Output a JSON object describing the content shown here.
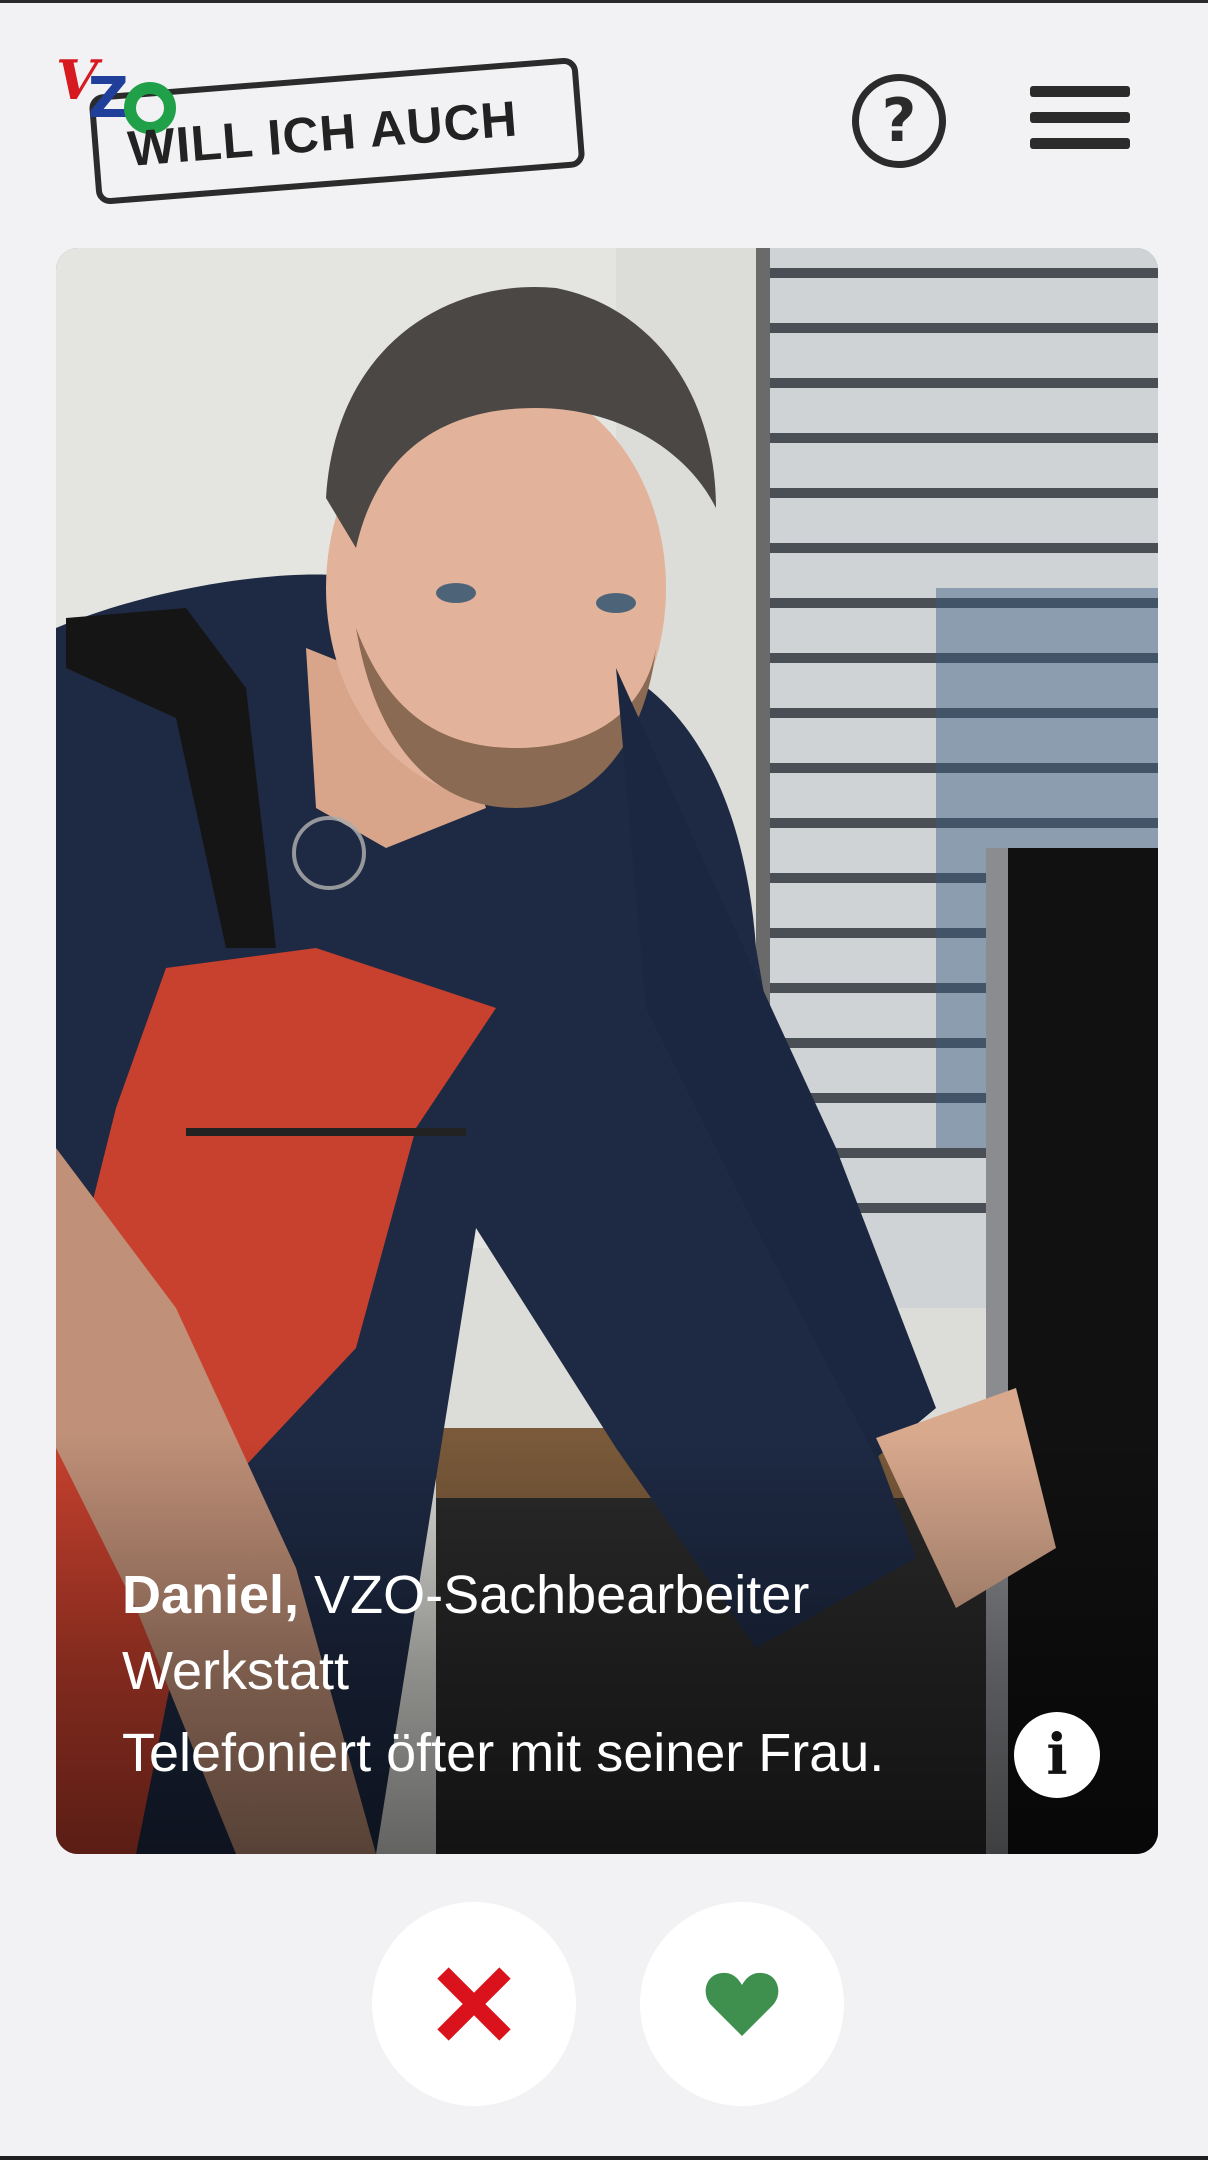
{
  "header": {
    "logo_letters": {
      "v": "V",
      "z": "Z",
      "o": "O"
    },
    "logo_text": "WILL ICH AUCH",
    "help_label": "?",
    "menu_icon": "hamburger-menu-icon"
  },
  "profile": {
    "name": "Daniel,",
    "role": "VZO-Sachbearbeiter",
    "department": "Werkstatt",
    "fact": "Telefoniert öfter mit seiner Frau.",
    "info_label": "i"
  },
  "actions": {
    "dislike_icon": "close-x-icon",
    "like_icon": "heart-icon"
  },
  "colors": {
    "background": "#f2f2f4",
    "dislike": "#d9121b",
    "like": "#3f8f4f",
    "logo_red": "#d61a1f",
    "logo_blue": "#1f3f9a",
    "logo_green": "#21a04a"
  }
}
